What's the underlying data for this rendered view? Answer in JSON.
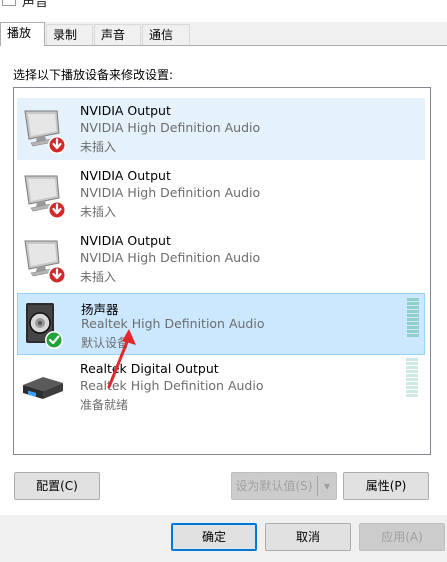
{
  "window": {
    "title": "声音"
  },
  "tabs": [
    {
      "label": "播放"
    },
    {
      "label": "录制"
    },
    {
      "label": "声音"
    },
    {
      "label": "通信"
    }
  ],
  "instruction": "选择以下播放设备来修改设置:",
  "devices": [
    {
      "name": "NVIDIA Output",
      "driver": "NVIDIA High Definition Audio",
      "status": "未插入",
      "icon": "monitor-icon",
      "badge": "unplugged-red-arrow-icon"
    },
    {
      "name": "NVIDIA Output",
      "driver": "NVIDIA High Definition Audio",
      "status": "未插入",
      "icon": "monitor-icon",
      "badge": "unplugged-red-arrow-icon"
    },
    {
      "name": "NVIDIA Output",
      "driver": "NVIDIA High Definition Audio",
      "status": "未插入",
      "icon": "monitor-icon",
      "badge": "unplugged-red-arrow-icon"
    },
    {
      "name": "扬声器",
      "driver": "Realtek High Definition Audio",
      "status": "默认设备",
      "icon": "speaker-icon",
      "badge": "default-green-check-icon",
      "selected": true
    },
    {
      "name": "Realtek Digital Output",
      "driver": "Realtek High Definition Audio",
      "status": "准备就绪",
      "icon": "digital-output-icon"
    }
  ],
  "buttons": {
    "configure": "配置(C)",
    "set_default": "设为默认值(S)",
    "set_default_arrow": "▾",
    "properties": "属性(P)",
    "ok": "确定",
    "cancel": "取消",
    "apply": "应用(A)"
  },
  "colors": {
    "accent": "#0078d7",
    "selection": "#cce8ff",
    "hover": "#e5f1fb",
    "annotation_arrow": "#e0282e"
  }
}
